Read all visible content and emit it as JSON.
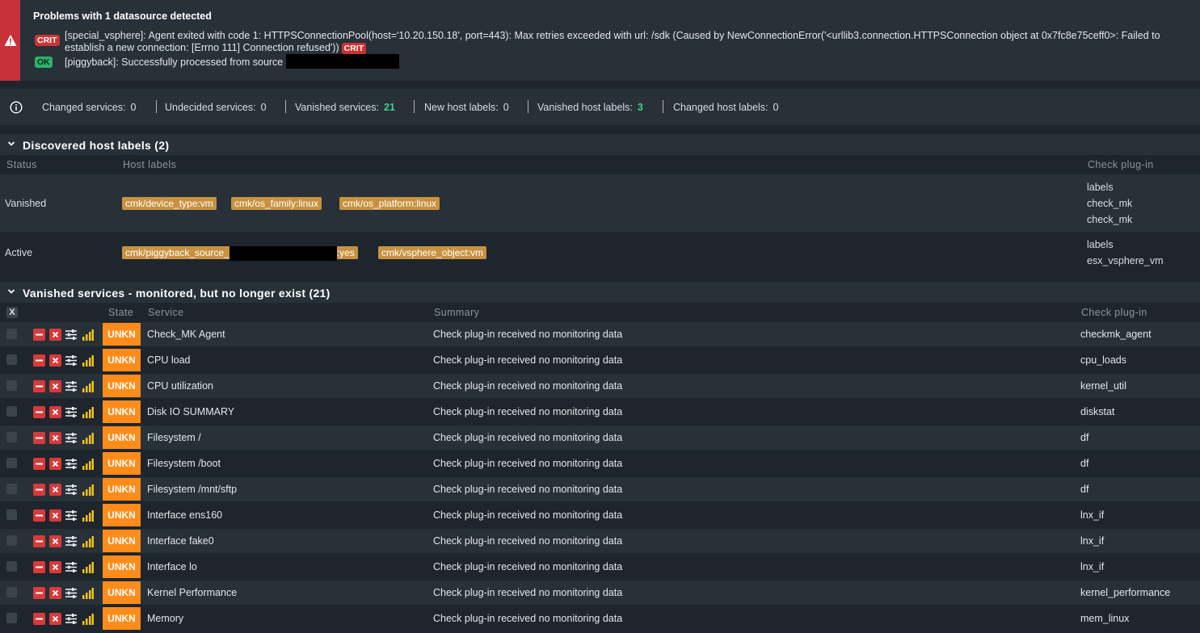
{
  "problem": {
    "title": "Problems with 1 datasource detected",
    "entries": [
      {
        "badge": "CRIT",
        "text": "[special_vsphere]: Agent exited with code 1: HTTPSConnectionPool(host='10.20.150.18', port=443): Max retries exceeded with url: /sdk (Caused by NewConnectionError('<urllib3.connection.HTTPSConnection object at 0x7fc8e75ceff0>: Failed to establish a new connection: [Errno 111] Connection refused'))",
        "trail_badge": "CRIT"
      },
      {
        "badge": "OK",
        "text": "[piggyback]: Successfully processed from source"
      }
    ]
  },
  "summary": {
    "changed": {
      "label": "Changed services:",
      "value": "0"
    },
    "undecided": {
      "label": "Undecided services:",
      "value": "0"
    },
    "vanished": {
      "label": "Vanished services:",
      "value": "21"
    },
    "new_labels": {
      "label": "New host labels:",
      "value": "0"
    },
    "vanished_labels": {
      "label": "Vanished host labels:",
      "value": "3"
    },
    "changed_labels": {
      "label": "Changed host labels:",
      "value": "0"
    }
  },
  "host_labels": {
    "title": "Discovered host labels (2)",
    "col_status": "Status",
    "col_labels": "Host labels",
    "col_plugin": "Check plug-in",
    "rows": [
      {
        "status": "Vanished",
        "labels": [
          "cmk/device_type:vm",
          "cmk/os_family:linux",
          "cmk/os_platform:linux"
        ],
        "plugins": [
          "labels",
          "check_mk",
          "check_mk"
        ]
      },
      {
        "status": "Active",
        "labels": [
          "cmk/piggyback_source_",
          ":yes",
          "cmk/vsphere_object:vm"
        ],
        "plugins": [
          "labels",
          "esx_vsphere_vm"
        ]
      }
    ]
  },
  "vanished": {
    "title": "Vanished services - monitored, but no longer exist (21)",
    "x_label": "X",
    "col_state": "State",
    "col_service": "Service",
    "col_summary": "Summary",
    "col_plugin": "Check plug-in",
    "rows": [
      {
        "state": "UNKN",
        "service": "Check_MK Agent",
        "summary": "Check plug-in received no monitoring data",
        "plugin": "checkmk_agent"
      },
      {
        "state": "UNKN",
        "service": "CPU load",
        "summary": "Check plug-in received no monitoring data",
        "plugin": "cpu_loads"
      },
      {
        "state": "UNKN",
        "service": "CPU utilization",
        "summary": "Check plug-in received no monitoring data",
        "plugin": "kernel_util"
      },
      {
        "state": "UNKN",
        "service": "Disk IO SUMMARY",
        "summary": "Check plug-in received no monitoring data",
        "plugin": "diskstat"
      },
      {
        "state": "UNKN",
        "service": "Filesystem /",
        "summary": "Check plug-in received no monitoring data",
        "plugin": "df"
      },
      {
        "state": "UNKN",
        "service": "Filesystem /boot",
        "summary": "Check plug-in received no monitoring data",
        "plugin": "df"
      },
      {
        "state": "UNKN",
        "service": "Filesystem /mnt/sftp",
        "summary": "Check plug-in received no monitoring data",
        "plugin": "df"
      },
      {
        "state": "UNKN",
        "service": "Interface ens160",
        "summary": "Check plug-in received no monitoring data",
        "plugin": "lnx_if"
      },
      {
        "state": "UNKN",
        "service": "Interface fake0",
        "summary": "Check plug-in received no monitoring data",
        "plugin": "lnx_if"
      },
      {
        "state": "UNKN",
        "service": "Interface lo",
        "summary": "Check plug-in received no monitoring data",
        "plugin": "lnx_if"
      },
      {
        "state": "UNKN",
        "service": "Kernel Performance",
        "summary": "Check plug-in received no monitoring data",
        "plugin": "kernel_performance"
      },
      {
        "state": "UNKN",
        "service": "Memory",
        "summary": "Check plug-in received no monitoring data",
        "plugin": "mem_linux"
      }
    ]
  }
}
